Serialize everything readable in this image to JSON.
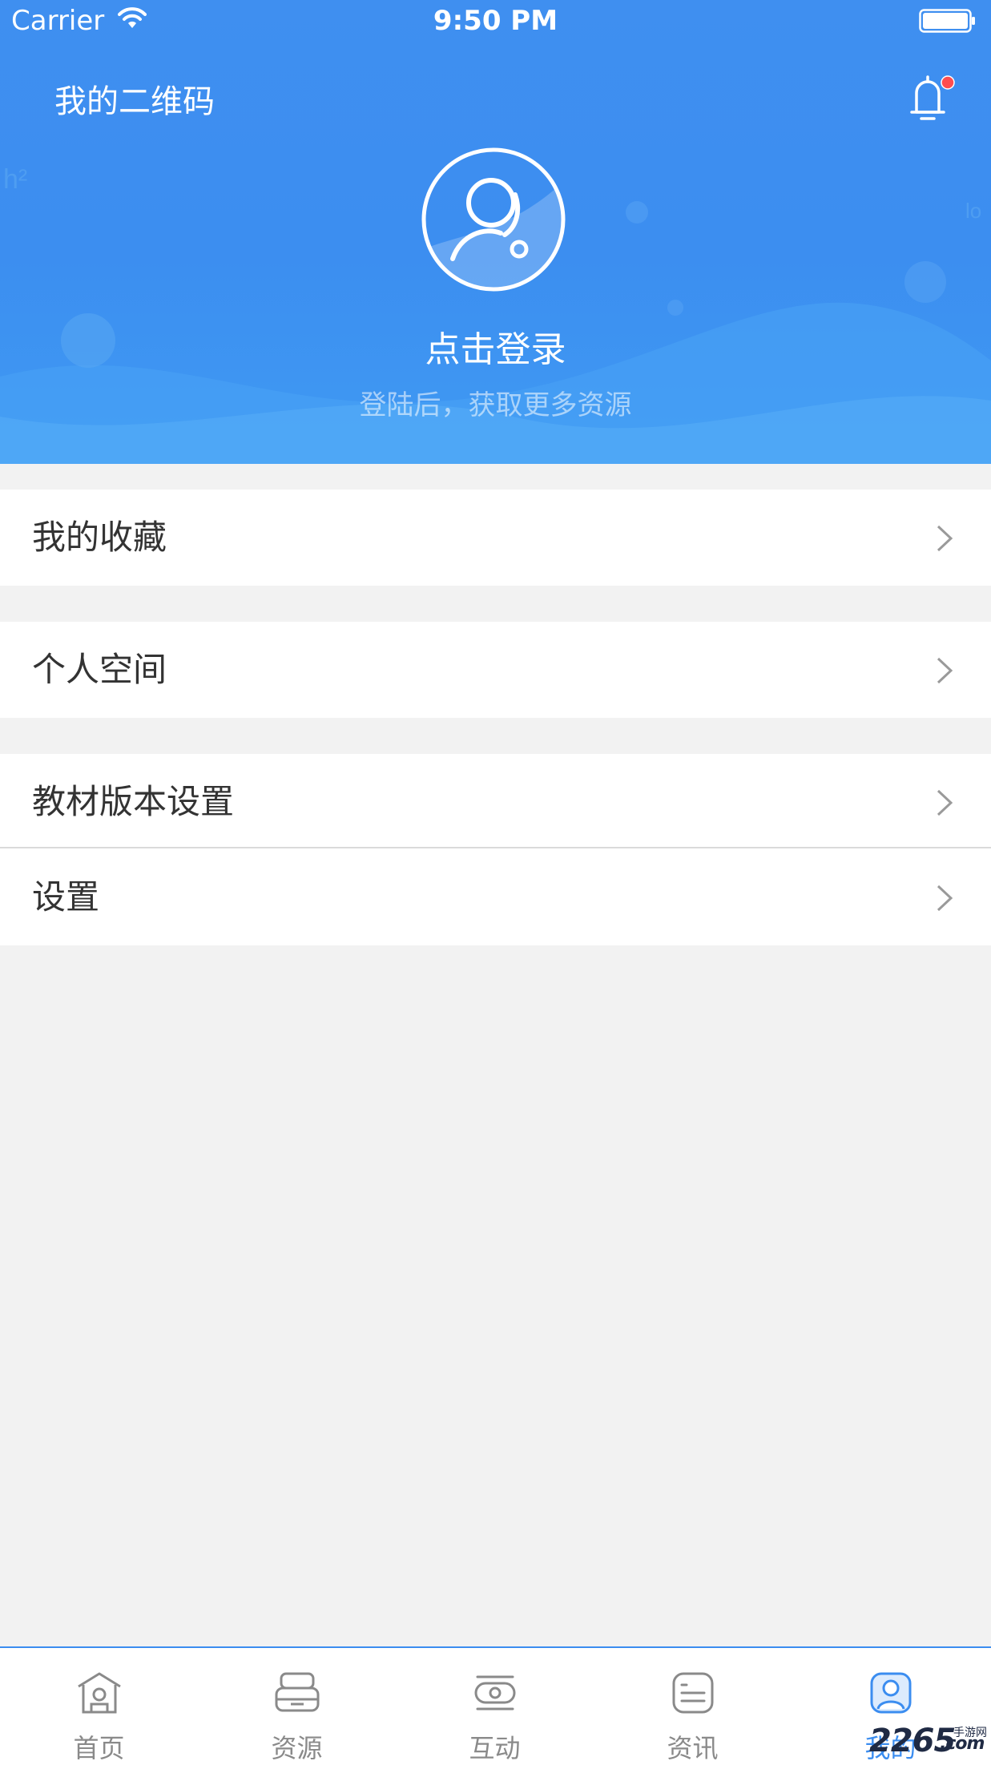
{
  "status_bar": {
    "carrier": "Carrier",
    "time": "9:50 PM"
  },
  "header": {
    "qr_title": "我的二维码",
    "login_title": "点击登录",
    "login_subtitle": "登陆后，获取更多资源",
    "bell_has_badge": true,
    "badge_color": "#ff4d4f",
    "accent_color": "#3b8df0"
  },
  "menu": {
    "favorites": "我的收藏",
    "personal_space": "个人空间",
    "textbook_version": "教材版本设置",
    "settings": "设置"
  },
  "tabbar": {
    "active": "mine",
    "tabs": [
      {
        "id": "home",
        "label": "首页",
        "icon": "home-icon"
      },
      {
        "id": "resources",
        "label": "资源",
        "icon": "resources-icon"
      },
      {
        "id": "interact",
        "label": "互动",
        "icon": "interact-icon"
      },
      {
        "id": "news",
        "label": "资讯",
        "icon": "news-icon"
      },
      {
        "id": "mine",
        "label": "我的",
        "icon": "user-icon"
      }
    ]
  },
  "watermark": {
    "brand": "2265",
    "suffix": ".com",
    "caption": "手游网"
  }
}
